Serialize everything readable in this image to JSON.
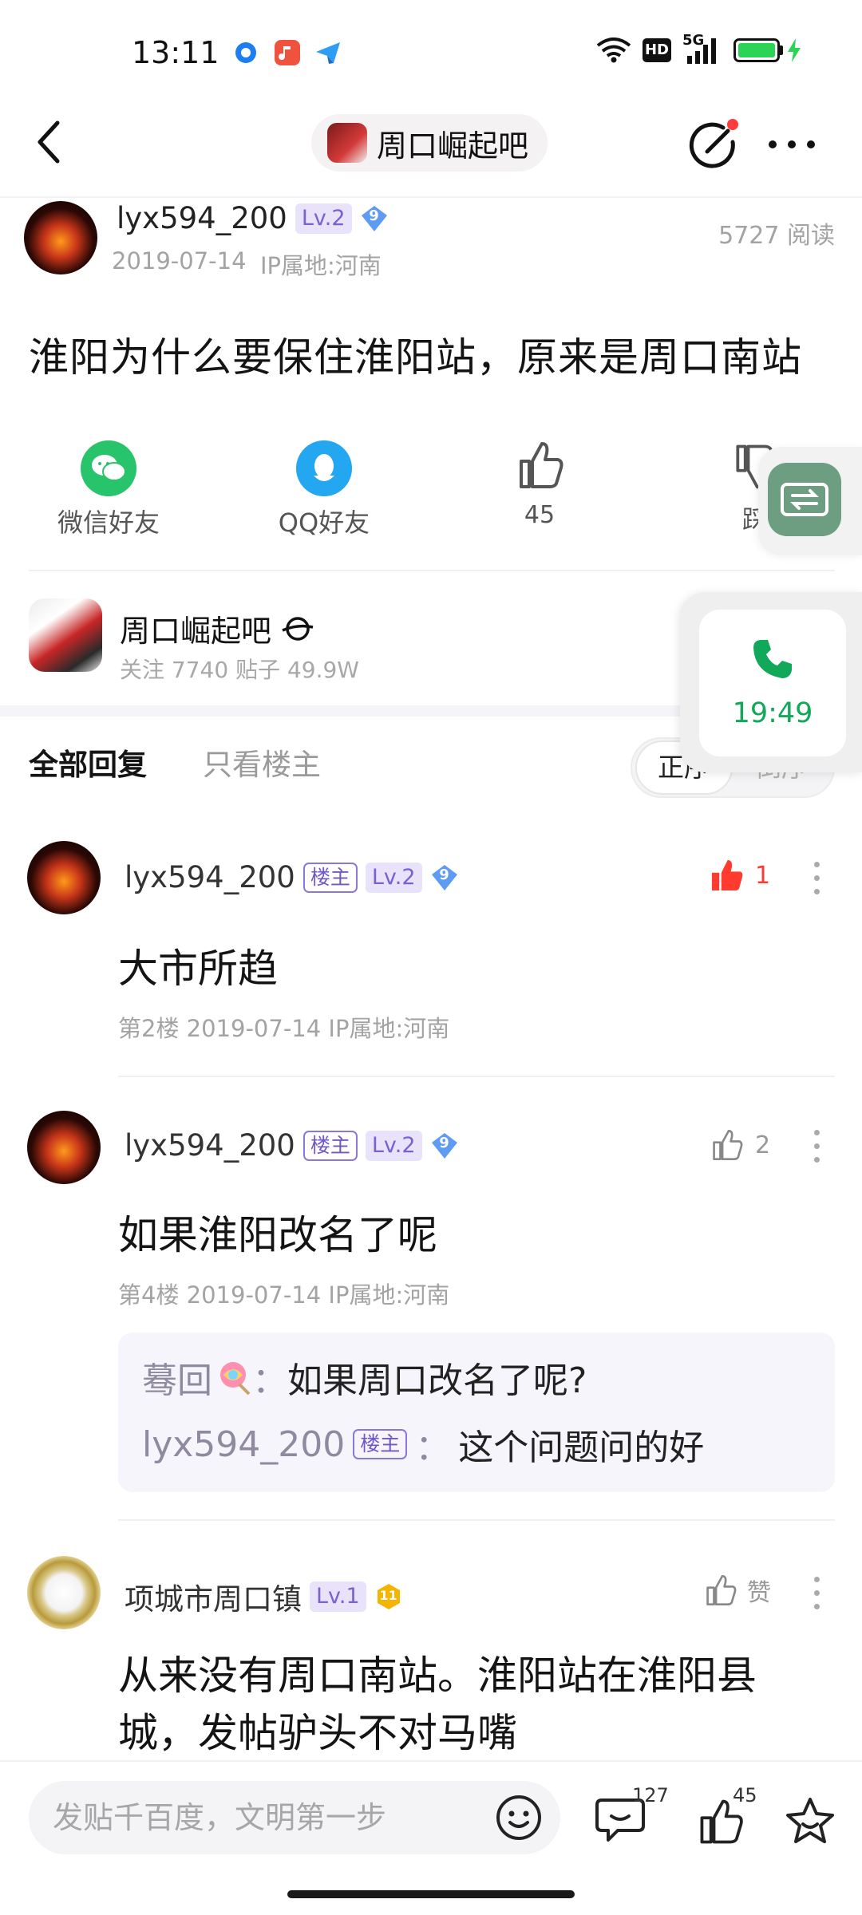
{
  "status_bar": {
    "time": "13:11",
    "network": "5G",
    "hd": "HD"
  },
  "header": {
    "forum_pill": "周口崛起吧"
  },
  "post": {
    "author": "lyx594_200",
    "level": "Lv.2",
    "diamond": "9",
    "date": "2019-07-14",
    "ip": "IP属地:河南",
    "reads": "5727 阅读",
    "title": "淮阳为什么要保住淮阳站，原来是周口南站"
  },
  "share": {
    "wechat": "微信好友",
    "qq": "QQ好友",
    "like_count": "45",
    "dislike": "踩"
  },
  "forum": {
    "name": "周口崛起吧",
    "stats": "关注 7740   贴子 49.9W"
  },
  "tabs": {
    "all": "全部回复",
    "host_only": "只看楼主",
    "sort_asc": "正序",
    "sort_desc": "倒序"
  },
  "replies": [
    {
      "author": "lyx594_200",
      "host_badge": "楼主",
      "level": "Lv.2",
      "diamond": "9",
      "like": "1",
      "body": "大市所趋",
      "meta": "第2楼  2019-07-14  IP属地:河南"
    },
    {
      "author": "lyx594_200",
      "host_badge": "楼主",
      "level": "Lv.2",
      "diamond": "9",
      "like": "2",
      "body": "如果淮阳改名了呢",
      "meta": "第4楼  2019-07-14  IP属地:河南",
      "sub_replies": [
        {
          "name": "蓦回",
          "sep": "：",
          "text": "如果周口改名了呢?"
        },
        {
          "name": "lyx594_200",
          "badge": "楼主",
          "sep": "：",
          "text": "这个问题问的好"
        }
      ]
    },
    {
      "author": "项城市周口镇",
      "level": "Lv.1",
      "diamond": "11",
      "like": "赞",
      "body": "从来没有周口南站。淮阳站在淮阳县城，发帖驴头不对马嘴"
    }
  ],
  "floating_call": {
    "time": "19:49"
  },
  "bottom_bar": {
    "input_placeholder": "发贴千百度，文明第一步",
    "comment_count": "127",
    "like_count": "45"
  },
  "colors": {
    "accent_purple": "#7b61ce",
    "like_red": "#ff3b30",
    "call_green": "#11a85a",
    "wechat_green": "#27c46b",
    "qq_blue": "#22a7f0"
  }
}
